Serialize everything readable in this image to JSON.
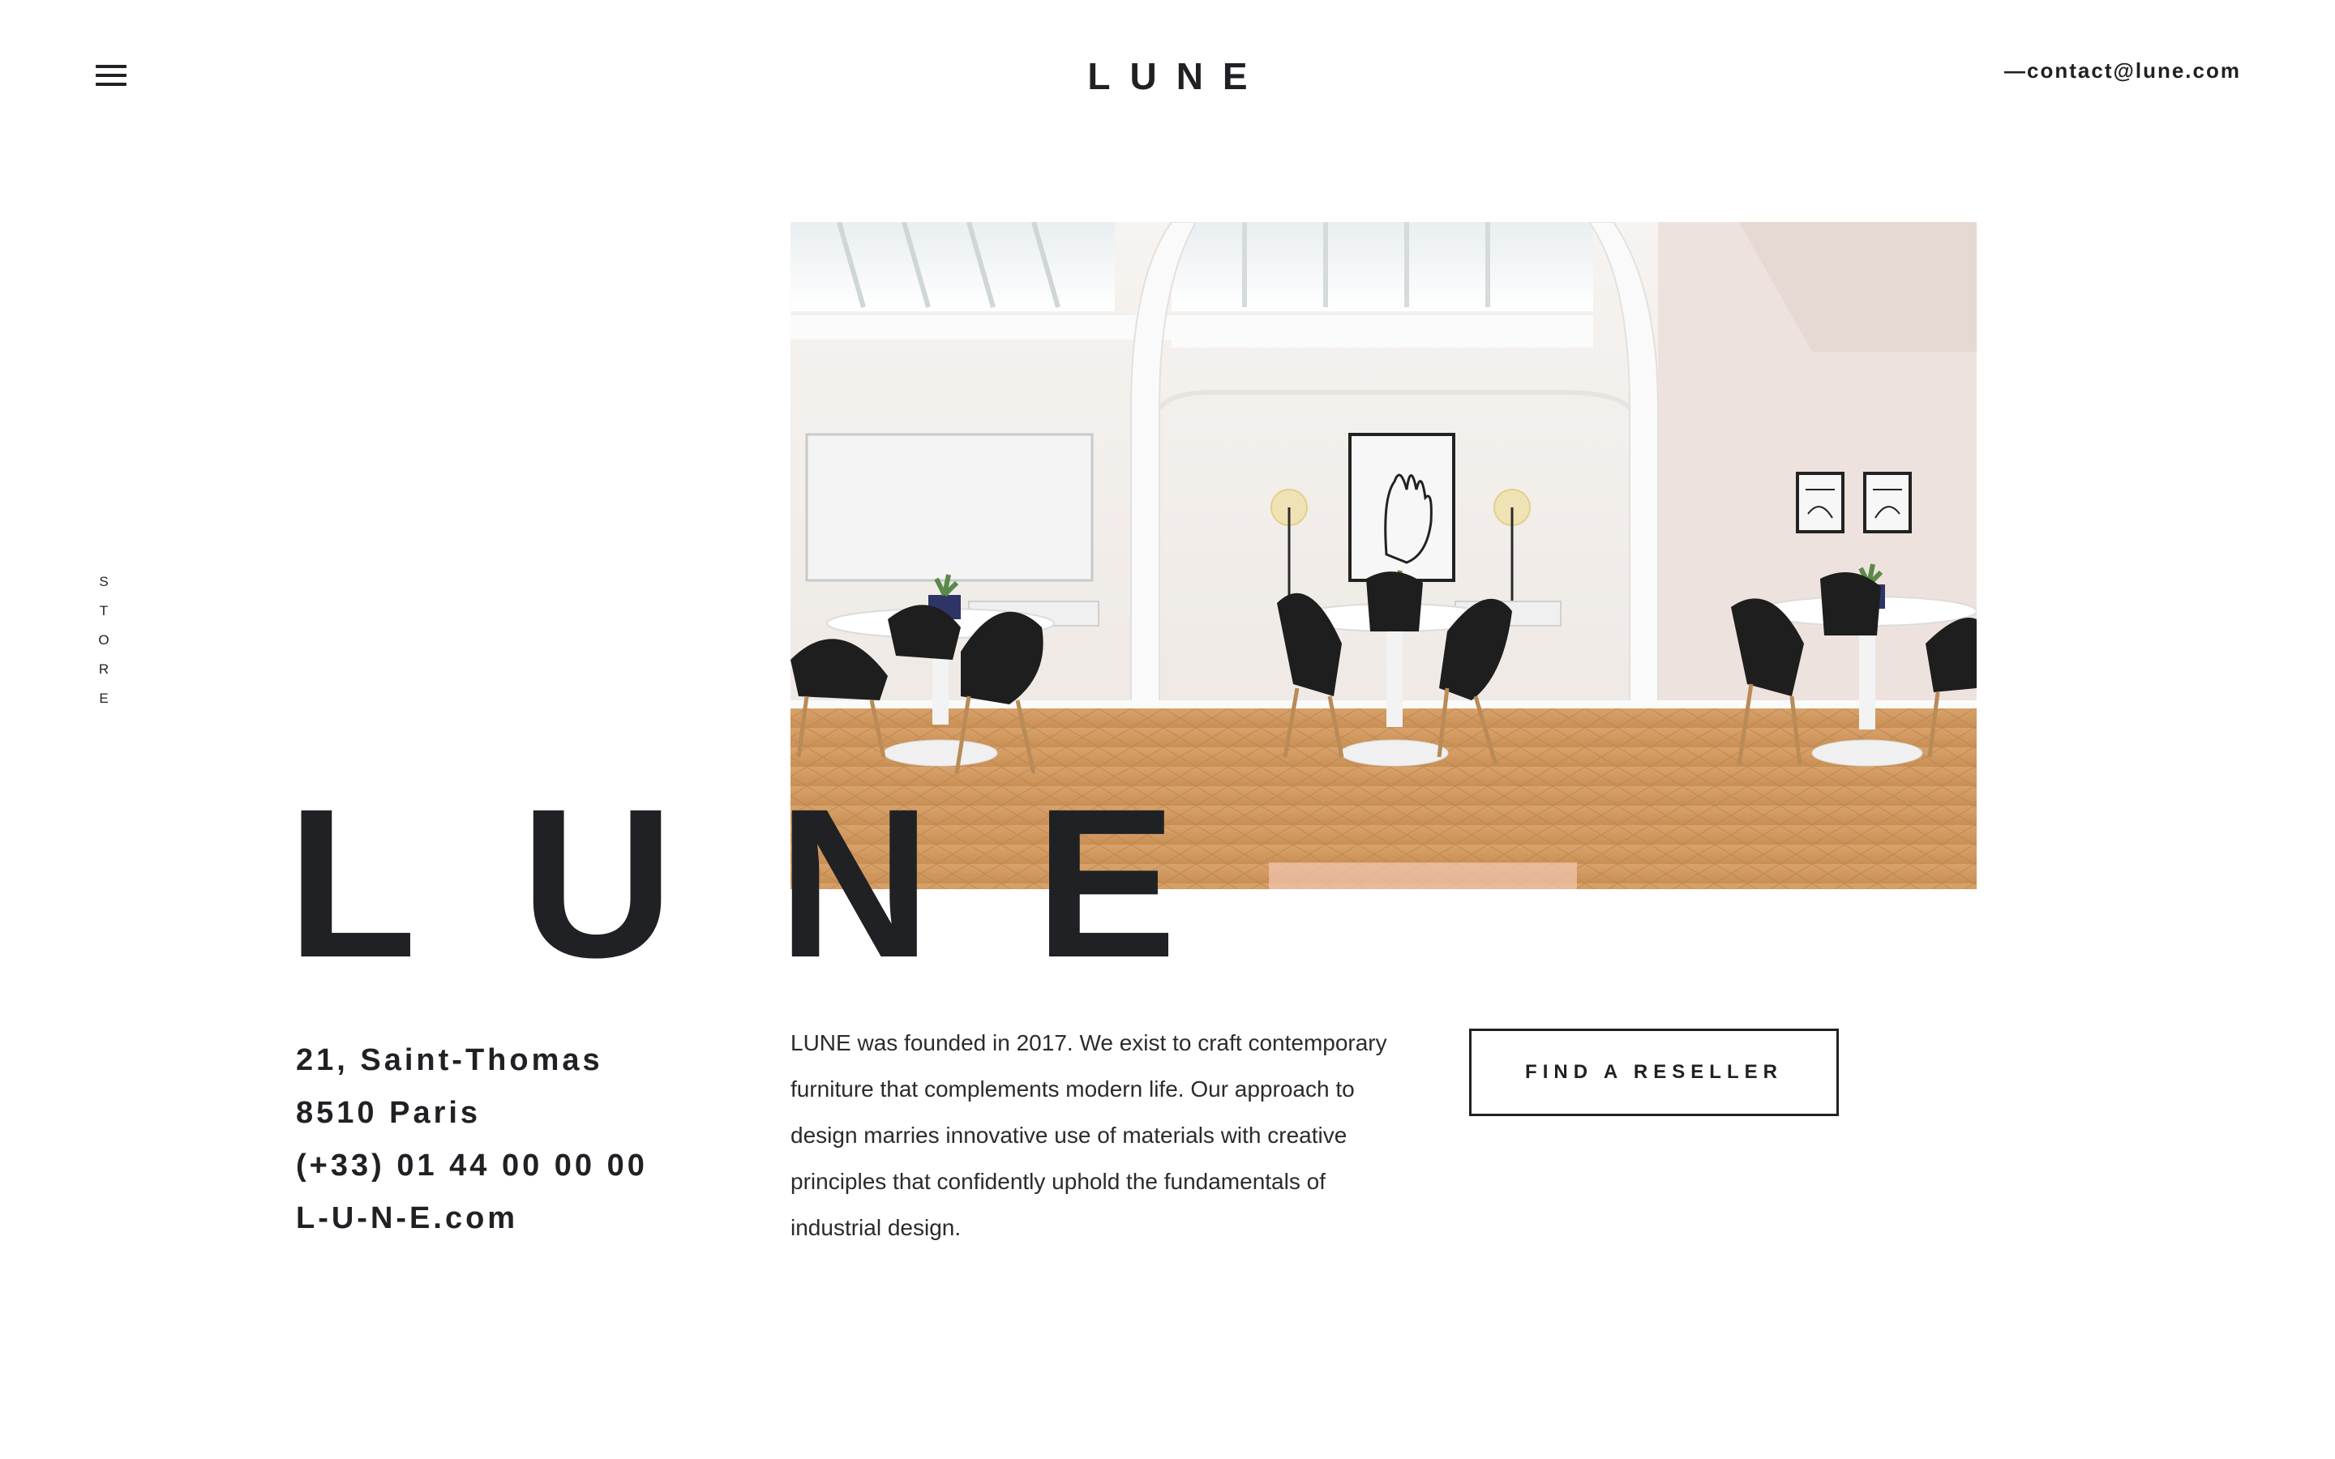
{
  "header": {
    "logo": "LUNE",
    "contact": "—contact@lune.com"
  },
  "side_label": [
    "S",
    "T",
    "O",
    "R",
    "E"
  ],
  "hero": {
    "brand_letters": [
      "L",
      "U",
      "N",
      "E"
    ]
  },
  "address": {
    "line1": "21, Saint-Thomas",
    "line2": "8510 Paris",
    "phone": "(+33) 01 44 00 00 00",
    "website": "L-U-N-E.com"
  },
  "about": {
    "text": "LUNE was founded in 2017. We exist to craft contemporary furniture that complements modern life. Our approach to design marries innovative use of materials with creative principles that confidently uphold the fundamentals of industrial design."
  },
  "cta": {
    "label": "FIND A RESELLER"
  },
  "colors": {
    "text": "#202124",
    "background": "#ffffff",
    "floor": "#d9a772",
    "wall": "#f1ece8"
  },
  "icons": {
    "menu": "hamburger-menu-icon"
  }
}
